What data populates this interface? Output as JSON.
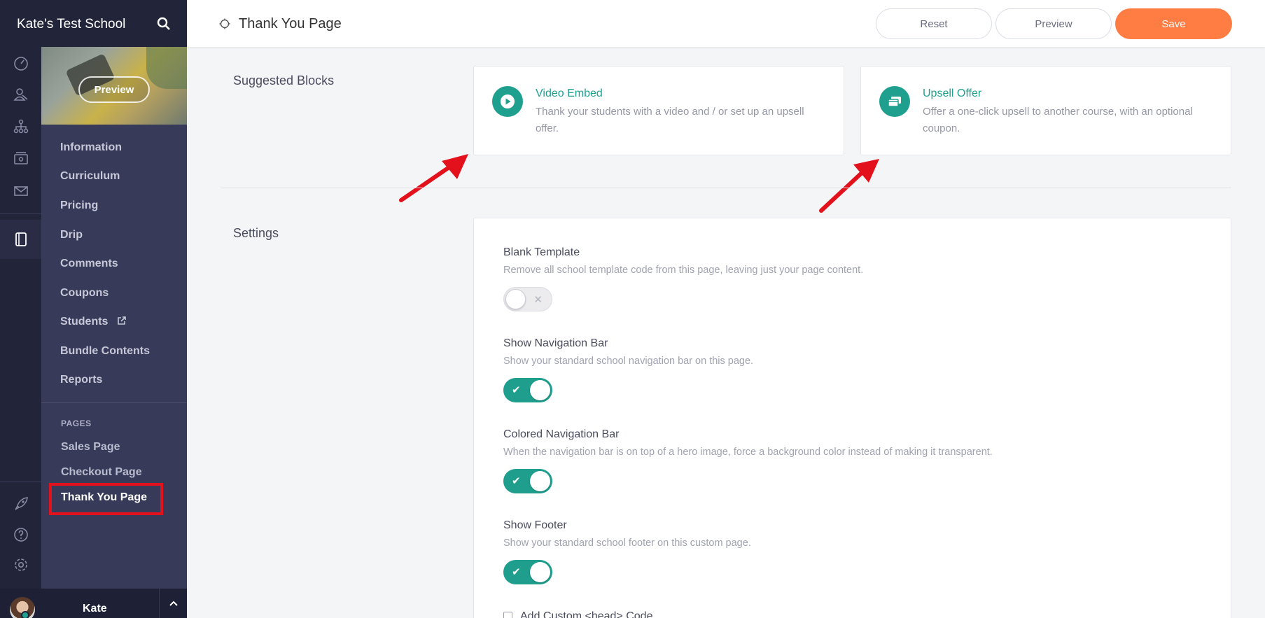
{
  "school": {
    "name": "Kate's Test School"
  },
  "course": {
    "preview_label": "Preview"
  },
  "course_nav": [
    "Information",
    "Curriculum",
    "Pricing",
    "Drip",
    "Comments",
    "Coupons",
    "Students",
    "Bundle Contents",
    "Reports"
  ],
  "pages": {
    "heading": "PAGES",
    "items": [
      "Sales Page",
      "Checkout Page",
      "Thank You Page"
    ],
    "active": "Thank You Page"
  },
  "user": {
    "name": "Kate"
  },
  "topbar": {
    "title": "Thank You Page",
    "reset_label": "Reset",
    "preview_label": "Preview",
    "save_label": "Save"
  },
  "suggested": {
    "heading": "Suggested Blocks",
    "blocks": [
      {
        "title": "Video Embed",
        "desc": "Thank your students with a video and / or set up an upsell offer.",
        "icon": "play-icon"
      },
      {
        "title": "Upsell Offer",
        "desc": "Offer a one-click upsell to another course, with an optional coupon.",
        "icon": "cards-icon"
      }
    ]
  },
  "settings": {
    "heading": "Settings",
    "items": [
      {
        "title": "Blank Template",
        "desc": "Remove all school template code from this page, leaving just your page content.",
        "enabled": false
      },
      {
        "title": "Show Navigation Bar",
        "desc": "Show your standard school navigation bar on this page.",
        "enabled": true
      },
      {
        "title": "Colored Navigation Bar",
        "desc": "When the navigation bar is on top of a hero image, force a background color instead of making it transparent.",
        "enabled": true
      },
      {
        "title": "Show Footer",
        "desc": "Show your standard school footer on this custom page.",
        "enabled": true
      }
    ],
    "custom_head_label": "Add Custom <head> Code"
  },
  "colors": {
    "accent": "#1fa08f",
    "save": "#ff7c43",
    "sidebar": "#383a5a",
    "rail": "#22243a",
    "annotation": "#e3111b"
  }
}
